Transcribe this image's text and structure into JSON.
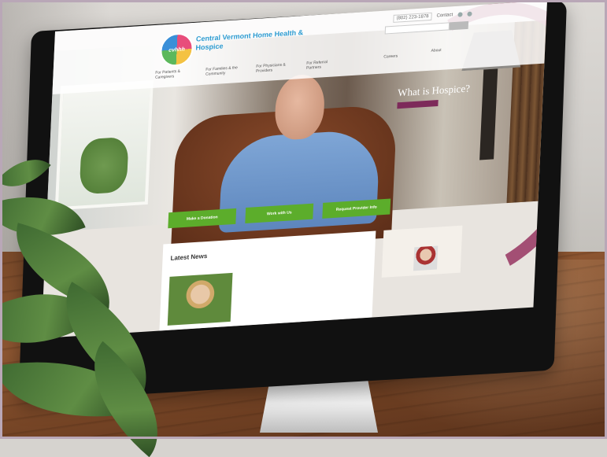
{
  "screen": {
    "org_name": "Central Vermont Home Health & Hospice",
    "logo_text": "cvhhh",
    "header": {
      "phone": "(802) 223-1878",
      "contact": "Contact"
    },
    "nav": [
      "For Patients & Caregivers",
      "For Families & the Community",
      "For Physicians & Providers",
      "For Referral Partners"
    ],
    "nav_extra": "Careers",
    "nav_about": "About",
    "promo": {
      "title": "What is Hospice?"
    },
    "cta": [
      "Make a Donation",
      "Work with Us",
      "Request Provider Info"
    ],
    "news": {
      "heading": "Latest News"
    }
  }
}
